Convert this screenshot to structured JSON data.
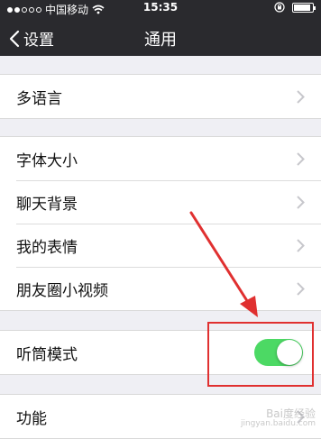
{
  "status_bar": {
    "carrier": "中国移动",
    "time": "15:35",
    "signal_dots_filled": 2,
    "signal_dots_total": 5,
    "battery_level": 0.9
  },
  "nav": {
    "back_label": "设置",
    "title": "通用"
  },
  "groups": [
    {
      "items": [
        {
          "label": "多语言",
          "type": "chevron"
        }
      ]
    },
    {
      "items": [
        {
          "label": "字体大小",
          "type": "chevron"
        },
        {
          "label": "聊天背景",
          "type": "chevron"
        },
        {
          "label": "我的表情",
          "type": "chevron"
        },
        {
          "label": "朋友圈小视频",
          "type": "chevron"
        }
      ]
    },
    {
      "items": [
        {
          "label": "听筒模式",
          "type": "toggle",
          "value": true
        }
      ]
    },
    {
      "items": [
        {
          "label": "功能",
          "type": "chevron"
        }
      ]
    }
  ],
  "colors": {
    "toggle_on": "#4cd964",
    "annotation": "#e03030",
    "nav_bg": "#2a2a2e"
  },
  "watermark": {
    "line1": "Bai度经验",
    "line2": "jingyan.baidu.com"
  }
}
